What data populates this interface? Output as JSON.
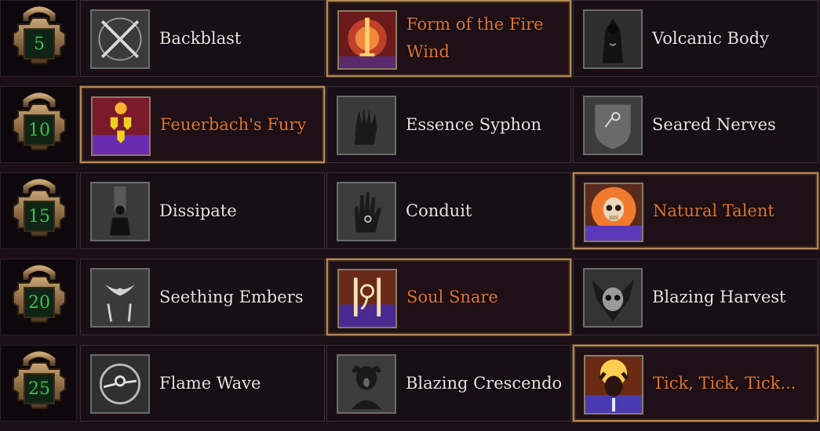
{
  "rows": [
    {
      "level": "5",
      "talents": [
        {
          "name": "Backblast",
          "icon": "crossed-swords-icon",
          "selected": false
        },
        {
          "name": "Form of the Fire Wind",
          "icon": "flaming-sword-icon",
          "selected": true
        },
        {
          "name": "Volcanic Body",
          "icon": "hooded-figure-icon",
          "selected": false
        }
      ]
    },
    {
      "level": "10",
      "talents": [
        {
          "name": "Feuerbach's Fury",
          "icon": "burning-shields-icon",
          "selected": true
        },
        {
          "name": "Essence Syphon",
          "icon": "grasping-hand-icon",
          "selected": false
        },
        {
          "name": "Seared Nerves",
          "icon": "shield-rune-icon",
          "selected": false
        }
      ]
    },
    {
      "level": "15",
      "talents": [
        {
          "name": "Dissipate",
          "icon": "dissolving-figure-icon",
          "selected": false
        },
        {
          "name": "Conduit",
          "icon": "open-hand-rune-icon",
          "selected": false
        },
        {
          "name": "Natural Talent",
          "icon": "flaming-skull-icon",
          "selected": true
        }
      ]
    },
    {
      "level": "20",
      "talents": [
        {
          "name": "Seething Embers",
          "icon": "dove-swords-icon",
          "selected": false
        },
        {
          "name": "Soul Snare",
          "icon": "twin-swords-rune-icon",
          "selected": true
        },
        {
          "name": "Blazing Harvest",
          "icon": "horned-skull-icon",
          "selected": false
        }
      ]
    },
    {
      "level": "25",
      "talents": [
        {
          "name": "Flame Wave",
          "icon": "fire-ring-icon",
          "selected": false
        },
        {
          "name": "Blazing Crescendo",
          "icon": "screaming-figure-icon",
          "selected": false
        },
        {
          "name": "Tick, Tick, Tick...",
          "icon": "burning-head-icon",
          "selected": true
        }
      ]
    }
  ]
}
